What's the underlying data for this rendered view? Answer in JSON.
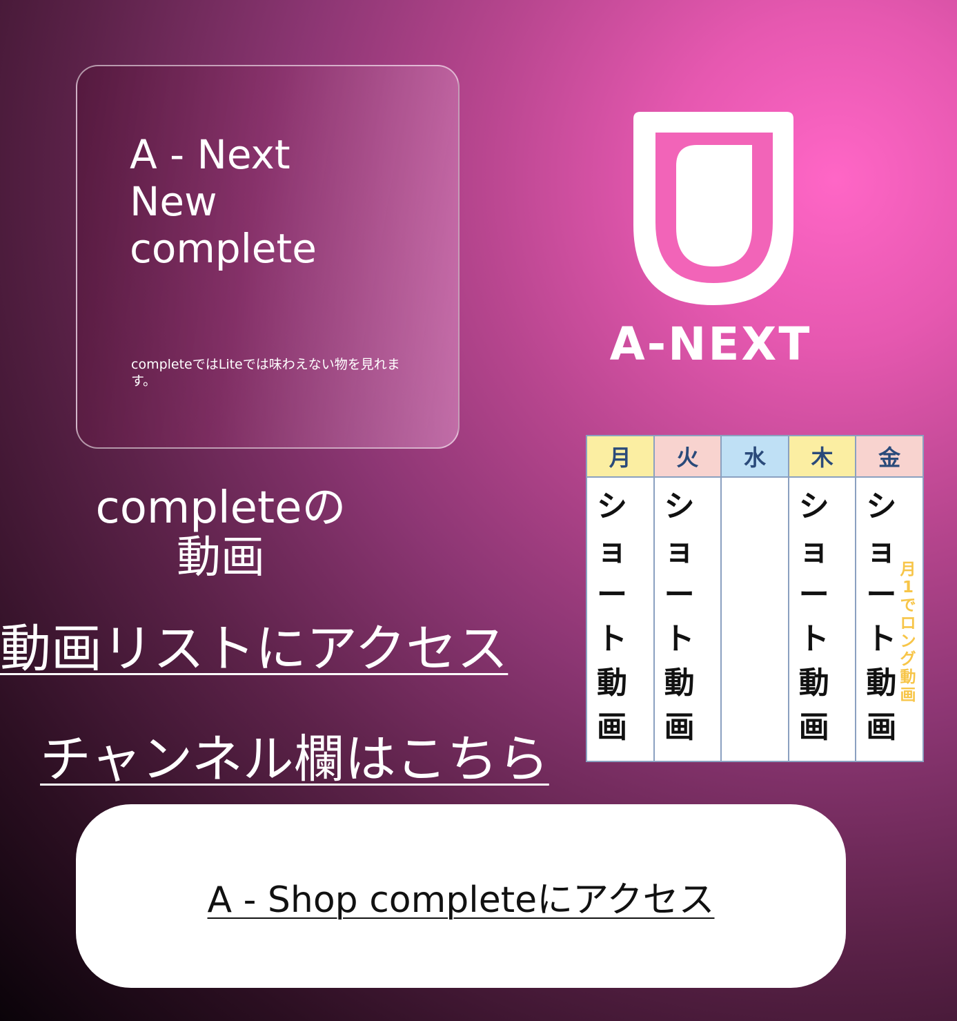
{
  "card": {
    "title_lines": [
      "A - Next",
      "New",
      "complete"
    ],
    "description": "completeではLiteでは味わえない物を見れます。"
  },
  "logo": {
    "text": "A-NEXT",
    "icon": "shield-icon"
  },
  "video_section": {
    "line1": "completeの",
    "line2": "動画"
  },
  "links": {
    "video_list": "動画リストにアクセス",
    "channel": "チャンネル欄はこちら"
  },
  "schedule": {
    "days": [
      {
        "label": "月",
        "header_color": "#fbeea2",
        "content": [
          "シ",
          "ョ",
          "ー",
          "ト",
          "動",
          "画"
        ]
      },
      {
        "label": "火",
        "header_color": "#f8d3cf",
        "content": [
          "シ",
          "ョ",
          "ー",
          "ト",
          "動",
          "画"
        ]
      },
      {
        "label": "水",
        "header_color": "#bfe0f5",
        "content": []
      },
      {
        "label": "木",
        "header_color": "#fbeea2",
        "content": [
          "シ",
          "ョ",
          "ー",
          "ト",
          "動",
          "画"
        ]
      },
      {
        "label": "金",
        "header_color": "#f8d3cf",
        "content": [
          "シ",
          "ョ",
          "ー",
          "ト",
          "動",
          "画"
        ],
        "note": [
          "月",
          "1",
          "で",
          "ロ",
          "ン",
          "グ",
          "動",
          "画"
        ]
      }
    ]
  },
  "shop_button": {
    "label": "A - Shop completeにアクセス"
  },
  "colors": {
    "accent": "#ff66c6",
    "dark": "#0a0309"
  }
}
